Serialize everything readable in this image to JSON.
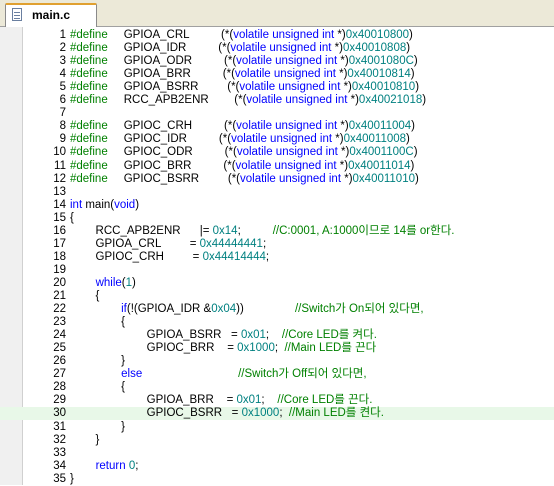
{
  "tab": {
    "filename": "main.c"
  },
  "lines": [
    {
      "n": "1",
      "segs": [
        [
          "pp",
          "#define"
        ],
        [
          "",
          "     GPIOA_CRL          (*("
        ],
        [
          "kw",
          "volatile unsigned int"
        ],
        [
          "",
          " *)"
        ],
        [
          "num",
          "0x40010800"
        ],
        [
          "",
          ")"
        ]
      ]
    },
    {
      "n": "2",
      "segs": [
        [
          "pp",
          "#define"
        ],
        [
          "",
          "     GPIOA_IDR          (*("
        ],
        [
          "kw",
          "volatile unsigned int"
        ],
        [
          "",
          " *)"
        ],
        [
          "num",
          "0x40010808"
        ],
        [
          "",
          ")"
        ]
      ]
    },
    {
      "n": "3",
      "segs": [
        [
          "pp",
          "#define"
        ],
        [
          "",
          "     GPIOA_ODR          (*("
        ],
        [
          "kw",
          "volatile unsigned int"
        ],
        [
          "",
          " *)"
        ],
        [
          "num",
          "0x4001080C"
        ],
        [
          "",
          ")"
        ]
      ]
    },
    {
      "n": "4",
      "segs": [
        [
          "pp",
          "#define"
        ],
        [
          "",
          "     GPIOA_BRR          (*("
        ],
        [
          "kw",
          "volatile unsigned int"
        ],
        [
          "",
          " *)"
        ],
        [
          "num",
          "0x40010814"
        ],
        [
          "",
          ")"
        ]
      ]
    },
    {
      "n": "5",
      "segs": [
        [
          "pp",
          "#define"
        ],
        [
          "",
          "     GPIOA_BSRR         (*("
        ],
        [
          "kw",
          "volatile unsigned int"
        ],
        [
          "",
          " *)"
        ],
        [
          "num",
          "0x40010810"
        ],
        [
          "",
          ")"
        ]
      ]
    },
    {
      "n": "6",
      "segs": [
        [
          "pp",
          "#define"
        ],
        [
          "",
          "     RCC_APB2ENR        (*("
        ],
        [
          "kw",
          "volatile unsigned int"
        ],
        [
          "",
          " *)"
        ],
        [
          "num",
          "0x40021018"
        ],
        [
          "",
          ")"
        ]
      ]
    },
    {
      "n": "7",
      "segs": []
    },
    {
      "n": "8",
      "segs": [
        [
          "pp",
          "#define"
        ],
        [
          "",
          "     GPIOC_CRH          (*("
        ],
        [
          "kw",
          "volatile unsigned int"
        ],
        [
          "",
          " *)"
        ],
        [
          "num",
          "0x40011004"
        ],
        [
          "",
          ")"
        ]
      ]
    },
    {
      "n": "9",
      "segs": [
        [
          "pp",
          "#define"
        ],
        [
          "",
          "     GPIOC_IDR          (*("
        ],
        [
          "kw",
          "volatile unsigned int"
        ],
        [
          "",
          " *)"
        ],
        [
          "num",
          "0x40011008"
        ],
        [
          "",
          ")"
        ]
      ]
    },
    {
      "n": "10",
      "segs": [
        [
          "pp",
          "#define"
        ],
        [
          "",
          "     GPIOC_ODR          (*("
        ],
        [
          "kw",
          "volatile unsigned int"
        ],
        [
          "",
          " *)"
        ],
        [
          "num",
          "0x4001100C"
        ],
        [
          "",
          ")"
        ]
      ]
    },
    {
      "n": "11",
      "segs": [
        [
          "pp",
          "#define"
        ],
        [
          "",
          "     GPIOC_BRR          (*("
        ],
        [
          "kw",
          "volatile unsigned int"
        ],
        [
          "",
          " *)"
        ],
        [
          "num",
          "0x40011014"
        ],
        [
          "",
          ")"
        ]
      ]
    },
    {
      "n": "12",
      "segs": [
        [
          "pp",
          "#define"
        ],
        [
          "",
          "     GPIOC_BSRR         (*("
        ],
        [
          "kw",
          "volatile unsigned int"
        ],
        [
          "",
          " *)"
        ],
        [
          "num",
          "0x40011010"
        ],
        [
          "",
          ")"
        ]
      ]
    },
    {
      "n": "13",
      "segs": []
    },
    {
      "n": "14",
      "segs": [
        [
          "kw",
          "int"
        ],
        [
          "",
          " main("
        ],
        [
          "kw",
          "void"
        ],
        [
          "",
          ")"
        ]
      ]
    },
    {
      "n": "15",
      "segs": [
        [
          "",
          "{"
        ]
      ]
    },
    {
      "n": "16",
      "segs": [
        [
          "",
          "        RCC_APB2ENR      |= "
        ],
        [
          "num",
          "0x14"
        ],
        [
          "",
          ";          "
        ],
        [
          "cm",
          "//C:0001, A:1000이므로 14를 or한다."
        ]
      ]
    },
    {
      "n": "17",
      "segs": [
        [
          "",
          "        GPIOA_CRL         = "
        ],
        [
          "num",
          "0x44444441"
        ],
        [
          "",
          ";"
        ]
      ]
    },
    {
      "n": "18",
      "segs": [
        [
          "",
          "        GPIOC_CRH         = "
        ],
        [
          "num",
          "0x44414444"
        ],
        [
          "",
          ";"
        ]
      ]
    },
    {
      "n": "19",
      "segs": []
    },
    {
      "n": "20",
      "segs": [
        [
          "",
          "        "
        ],
        [
          "kw",
          "while"
        ],
        [
          "",
          "("
        ],
        [
          "num",
          "1"
        ],
        [
          "",
          ")"
        ]
      ]
    },
    {
      "n": "21",
      "segs": [
        [
          "",
          "        {"
        ]
      ]
    },
    {
      "n": "22",
      "segs": [
        [
          "",
          "                "
        ],
        [
          "kw",
          "if"
        ],
        [
          "",
          "(!(GPIOA_IDR &"
        ],
        [
          "num",
          "0x04"
        ],
        [
          "",
          "))                "
        ],
        [
          "cm",
          "//Switch가 On되어 있다면,"
        ]
      ]
    },
    {
      "n": "23",
      "segs": [
        [
          "",
          "                {"
        ]
      ]
    },
    {
      "n": "24",
      "segs": [
        [
          "",
          "                        GPIOA_BSRR   = "
        ],
        [
          "num",
          "0x01"
        ],
        [
          "",
          ";    "
        ],
        [
          "cm",
          "//Core LED를 켜다."
        ]
      ]
    },
    {
      "n": "25",
      "segs": [
        [
          "",
          "                        GPIOC_BRR    = "
        ],
        [
          "num",
          "0x1000"
        ],
        [
          "",
          ";  "
        ],
        [
          "cm",
          "//Main LED를 끈다"
        ]
      ]
    },
    {
      "n": "26",
      "segs": [
        [
          "",
          "                }"
        ]
      ]
    },
    {
      "n": "27",
      "segs": [
        [
          "",
          "                "
        ],
        [
          "kw",
          "else"
        ],
        [
          "",
          "                              "
        ],
        [
          "cm",
          "//Switch가 Off되어 있다면,"
        ]
      ]
    },
    {
      "n": "28",
      "segs": [
        [
          "",
          "                {"
        ]
      ]
    },
    {
      "n": "29",
      "segs": [
        [
          "",
          "                        GPIOA_BRR    = "
        ],
        [
          "num",
          "0x01"
        ],
        [
          "",
          ";    "
        ],
        [
          "cm",
          "//Core LED를 끈다."
        ]
      ]
    },
    {
      "n": "30",
      "hl": true,
      "segs": [
        [
          "",
          "                        GPIOC_BSRR   = "
        ],
        [
          "num",
          "0x1000"
        ],
        [
          "",
          ";  "
        ],
        [
          "cm",
          "//Main LED를 켠다."
        ]
      ]
    },
    {
      "n": "31",
      "segs": [
        [
          "",
          "                }"
        ]
      ]
    },
    {
      "n": "32",
      "segs": [
        [
          "",
          "        }"
        ]
      ]
    },
    {
      "n": "33",
      "segs": []
    },
    {
      "n": "34",
      "segs": [
        [
          "",
          "        "
        ],
        [
          "kw",
          "return"
        ],
        [
          "",
          " "
        ],
        [
          "num",
          "0"
        ],
        [
          "",
          ";"
        ]
      ]
    },
    {
      "n": "35",
      "segs": [
        [
          "",
          "}"
        ]
      ]
    }
  ]
}
